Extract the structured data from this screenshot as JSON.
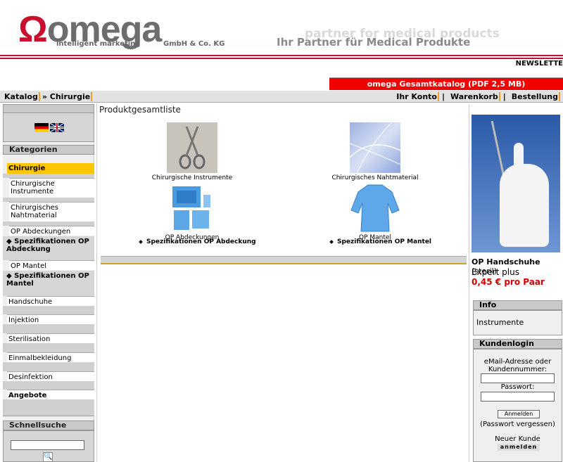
{
  "header": {
    "logo_symbol": "Ω",
    "logo_word": "omega",
    "logo_tagline": "intelligent marketing",
    "logo_company": "GmbH & Co. KG",
    "tagline_en": "partner for medical products",
    "tagline_de": "Ihr Partner für Medical Produkte",
    "newsletter": "NEWSLETTE",
    "catalog_link": "omega Gesamtkatalog (PDF 2,5 MB)"
  },
  "breadcrumb": {
    "root": "Katalog",
    "current": "» Chirurgie"
  },
  "topnav": {
    "account": "Ihr Konto",
    "cart": "Warenkorb",
    "order": "Bestellung",
    "sep": "|"
  },
  "left": {
    "categories_title": "Kategorien",
    "items": [
      {
        "label": "Chirurgie"
      },
      {
        "label": "Chirurgische Instrumente"
      },
      {
        "label": "Chirurgisches Nahtmaterial"
      },
      {
        "label": "OP Abdeckungen"
      },
      {
        "label": "Spezifikationen OP Abdeckung"
      },
      {
        "label": "OP Mantel"
      },
      {
        "label": "Spezifikationen OP Mantel"
      },
      {
        "label": "Handschuhe"
      },
      {
        "label": "Injektion"
      },
      {
        "label": "Sterilisation"
      },
      {
        "label": "Einmalbekleidung"
      },
      {
        "label": "Desinfektion"
      },
      {
        "label": "Angebote"
      }
    ],
    "quicksearch_title": "Schnellsuche"
  },
  "main": {
    "title": "Produktgesamtliste",
    "products": [
      {
        "caption": "Chirurgische Instrumente"
      },
      {
        "caption": "Chirurgisches Nahtmaterial"
      },
      {
        "caption": "OP Abdeckungen"
      },
      {
        "caption": "OP Mantel"
      }
    ],
    "specs": [
      "Spezifikationen OP Abdeckung",
      "Spezifikationen OP Mantel"
    ]
  },
  "right": {
    "product_name": "OP Handschuhe",
    "product_qual": "(steril)",
    "product_sub": "Expert plus",
    "product_price": "0,45 € pro Paar",
    "info_title": "Info",
    "info_text": "Instrumente",
    "login_title": "Kundenlogin",
    "email_label": "eMail-Adresse oder Kundennummer:",
    "password_label": "Passwort:",
    "login_button": "Anmelden",
    "forgot": "(Passwort vergessen)",
    "new_customer": "Neuer Kunde",
    "register_button": "anmelden"
  },
  "colors": {
    "brand_red": "#c8102e",
    "accent_orange": "#f0a020",
    "price_red": "#d40000"
  }
}
